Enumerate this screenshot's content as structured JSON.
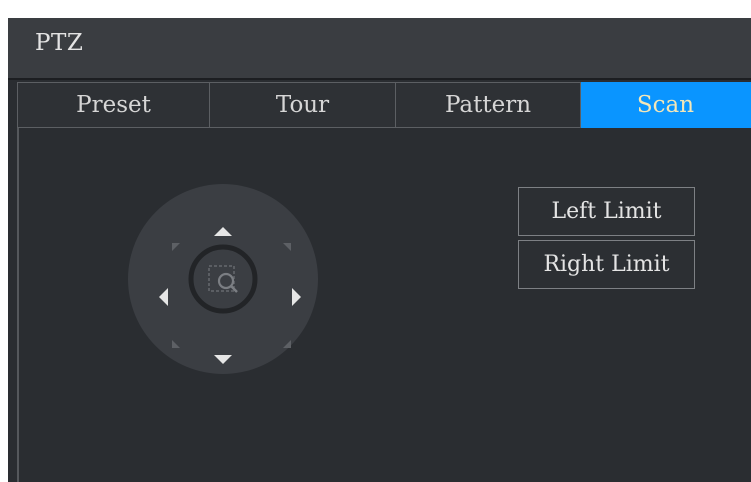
{
  "window": {
    "title": "PTZ"
  },
  "tabs": [
    {
      "label": "Preset",
      "active": false
    },
    {
      "label": "Tour",
      "active": false
    },
    {
      "label": "Pattern",
      "active": false
    },
    {
      "label": "Scan",
      "active": true
    }
  ],
  "scan": {
    "left_limit_label": "Left Limit",
    "right_limit_label": "Right Limit"
  },
  "colors": {
    "active_tab": "#0a95ff",
    "active_tab_text": "#f3e7b8",
    "panel_background": "#2a2d31"
  },
  "icons": [
    "arrow-up-icon",
    "arrow-down-icon",
    "arrow-left-icon",
    "arrow-right-icon",
    "arrow-up-left-icon",
    "arrow-up-right-icon",
    "arrow-down-left-icon",
    "arrow-down-right-icon",
    "zoom-search-icon"
  ]
}
